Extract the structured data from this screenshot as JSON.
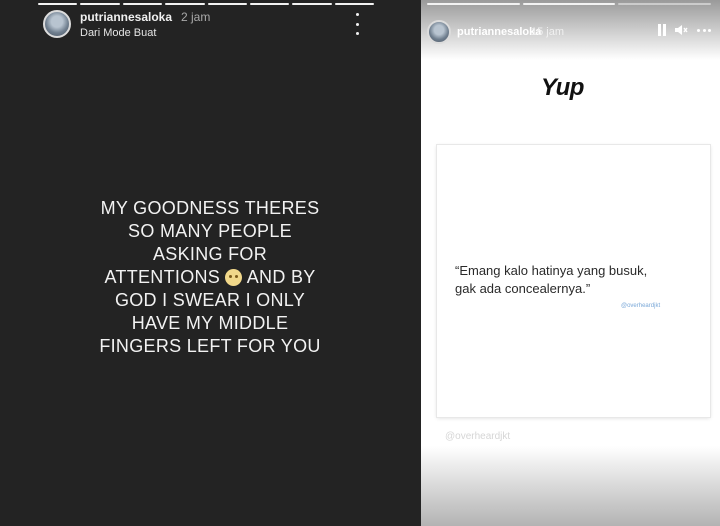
{
  "left_story": {
    "username": "putriannesaloka",
    "time": "2 jam",
    "subtitle": "Dari Mode Buat",
    "lines": [
      "MY GOODNESS THERES",
      "SO MANY PEOPLE",
      "ASKING FOR",
      "AND BY",
      "GOD I SWEAR I ONLY",
      "HAVE MY MIDDLE",
      "FINGERS LEFT FOR YOU"
    ],
    "attention_word": "ATTENTIONS",
    "emoji": "face-emoji",
    "progress_segments": 8,
    "progress_done": 8
  },
  "right_story": {
    "username": "putriannesaloka",
    "time": "15 jam",
    "headline": "Yup",
    "quote_line1": "“Emang kalo hatinya yang busuk,",
    "quote_line2": "gak ada concealernya.”",
    "card_handle": "@overheardjkt",
    "footer_handle": "@overheardjkt",
    "progress_segments": 3,
    "progress_done": 2,
    "icons": [
      "pause-icon",
      "volume-icon",
      "more-icon"
    ]
  }
}
